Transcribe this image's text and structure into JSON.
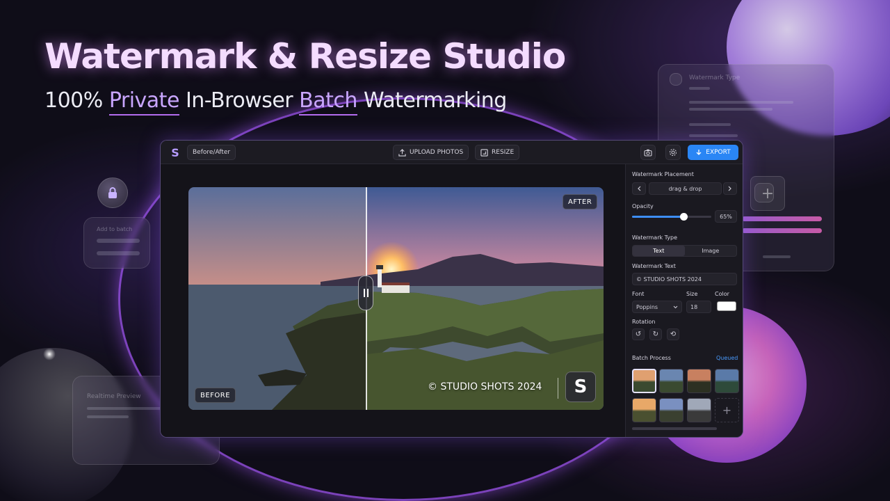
{
  "hero": {
    "title": "Watermark & Resize Studio",
    "subtitle_parts": [
      "100% ",
      "Private",
      " In-Browser ",
      "Batch",
      " Watermarking"
    ]
  },
  "toolbar": {
    "mode_label": "Before/After",
    "upload_label": "UPLOAD PHOTOS",
    "resize_label": "RESIZE",
    "export_label": "EXPORT"
  },
  "preview": {
    "before_label": "BEFORE",
    "after_label": "AFTER",
    "watermark_text": "© STUDIO SHOTS 2024",
    "watermark_logo": "S"
  },
  "panel": {
    "placement_title": "Watermark Placement",
    "placement_value": "drag & drop",
    "opacity_title": "Opacity",
    "opacity_value": "65%",
    "opacity_fraction": 0.65,
    "type_title": "Watermark Type",
    "type_options": [
      "Text",
      "Image"
    ],
    "type_selected": "Text",
    "text_title": "Watermark Text",
    "text_value": "© STUDIO SHOTS 2024",
    "font_title": "Font",
    "font_value": "Poppins",
    "size_title": "Size",
    "size_value": "18",
    "color_title": "Color",
    "color_value": "#ffffff",
    "rotation_title": "Rotation",
    "batch_title": "Batch Process",
    "batch_status": "Queued",
    "thumbnail_count": 7
  },
  "ghost_cards": {
    "right_title": "Watermark Type",
    "left_title": "Add to batch",
    "bottom_title": "Realtime Preview"
  },
  "colors": {
    "accent": "#2a86f5",
    "brand": "#b79cff",
    "glow": "#b46cf0"
  },
  "icons": [
    "logo-icon",
    "upload-icon",
    "resize-icon",
    "camera-icon",
    "settings-icon",
    "download-icon",
    "chevron-left-icon",
    "chevron-right-icon",
    "chevron-down-icon",
    "rotate-left-icon",
    "rotate-right-icon",
    "rotate-reset-icon",
    "plus-icon",
    "lock-icon"
  ]
}
